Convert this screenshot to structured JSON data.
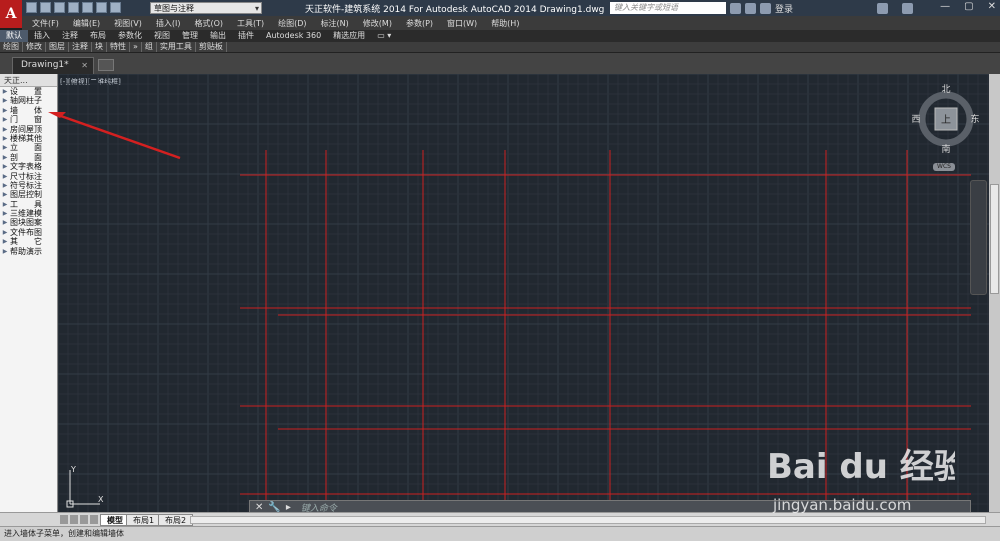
{
  "app": {
    "logo_letter": "A",
    "title": "天正软件-建筑系统 2014  For Autodesk AutoCAD 2014    Drawing1.dwg",
    "workspace": "草图与注释",
    "search_placeholder": "键入关键字或短语",
    "login_label": "登录"
  },
  "menu": [
    "文件(F)",
    "编辑(E)",
    "视图(V)",
    "插入(I)",
    "格式(O)",
    "工具(T)",
    "绘图(D)",
    "标注(N)",
    "修改(M)",
    "参数(P)",
    "窗口(W)",
    "帮助(H)"
  ],
  "ribbon_tabs": [
    "默认",
    "插入",
    "注释",
    "布局",
    "参数化",
    "视图",
    "管理",
    "输出",
    "插件",
    "Autodesk 360",
    "精选应用"
  ],
  "panels": [
    "绘图",
    "修改",
    "图层",
    "注释",
    "块",
    "特性",
    "»",
    "组",
    "实用工具",
    "剪贴板"
  ],
  "doc_tab": "Drawing1*",
  "tianzheng": {
    "header": "天正...",
    "items": [
      "设　　置",
      "轴网柱子",
      "墙　　体",
      "门　　窗",
      "房间屋顶",
      "楼梯其他",
      "立　　面",
      "剖　　面",
      "文字表格",
      "尺寸标注",
      "符号标注",
      "图层控制",
      "工　　具",
      "三维建模",
      "图块图案",
      "文件布图",
      "其　　它",
      "帮助演示"
    ]
  },
  "viewport": {
    "label": "[-][俯视][二维线框]",
    "compass": {
      "north": "北",
      "south": "南",
      "east": "东",
      "west": "西",
      "top": "上"
    },
    "wcs_label": "WCS",
    "grid_color": "#cc2020",
    "ucs_x": "X",
    "ucs_y": "Y"
  },
  "command": {
    "placeholder": "键入命令"
  },
  "layout_tabs": [
    "模型",
    "布局1",
    "布局2"
  ],
  "status": "进入墙体子菜单，创建和编辑墙体",
  "watermark": {
    "brand": "Bai du 经验",
    "url": "jingyan.baidu.com"
  }
}
